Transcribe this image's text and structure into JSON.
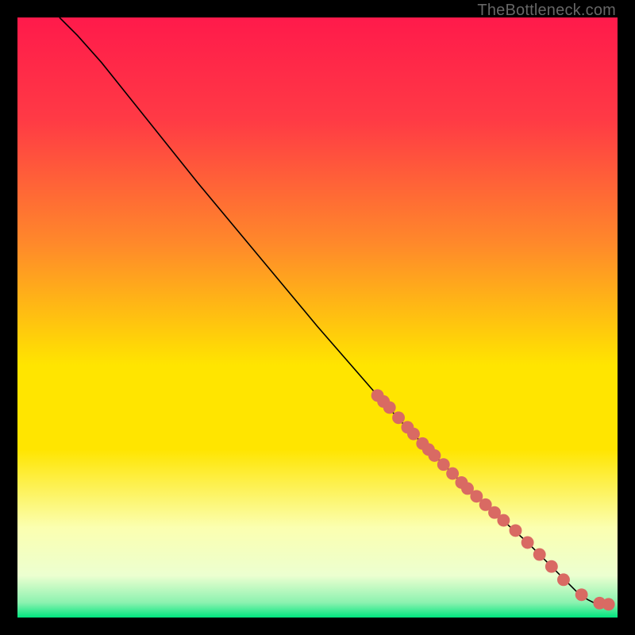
{
  "watermark": "TheBottleneck.com",
  "chart_data": {
    "type": "line",
    "title": "",
    "xlabel": "",
    "ylabel": "",
    "xlim": [
      0,
      100
    ],
    "ylim": [
      0,
      100
    ],
    "grid": false,
    "legend": false,
    "colors": {
      "gradient_top": "#ff1a4b",
      "gradient_mid_upper": "#ff8a2a",
      "gradient_mid": "#ffe500",
      "gradient_lower": "#fbffb0",
      "gradient_bottom": "#00e57e",
      "curve": "#000000",
      "markers": "#d96a63"
    },
    "curve": {
      "x": [
        7,
        10,
        14,
        20,
        30,
        40,
        50,
        60,
        65,
        70,
        75,
        80,
        85,
        88,
        90,
        92,
        93.5,
        95,
        96,
        97,
        98
      ],
      "y": [
        100,
        97,
        92.5,
        85,
        72.5,
        60.5,
        48.5,
        37,
        31.5,
        26.5,
        21.5,
        17,
        12.5,
        9.5,
        7.5,
        5.5,
        4,
        3,
        2.5,
        2.3,
        2.2
      ]
    },
    "markers": {
      "x": [
        60,
        61,
        62,
        63.5,
        65,
        66,
        67.5,
        68.5,
        69.5,
        71,
        72.5,
        74,
        75,
        76.5,
        78,
        79.5,
        81,
        83,
        85,
        87,
        89,
        91,
        94,
        97,
        98.5
      ],
      "y": [
        37,
        36,
        35,
        33.3,
        31.7,
        30.6,
        29,
        28,
        27,
        25.5,
        24,
        22.5,
        21.5,
        20.2,
        18.8,
        17.5,
        16.2,
        14.5,
        12.5,
        10.5,
        8.5,
        6.3,
        3.8,
        2.4,
        2.2
      ]
    }
  }
}
